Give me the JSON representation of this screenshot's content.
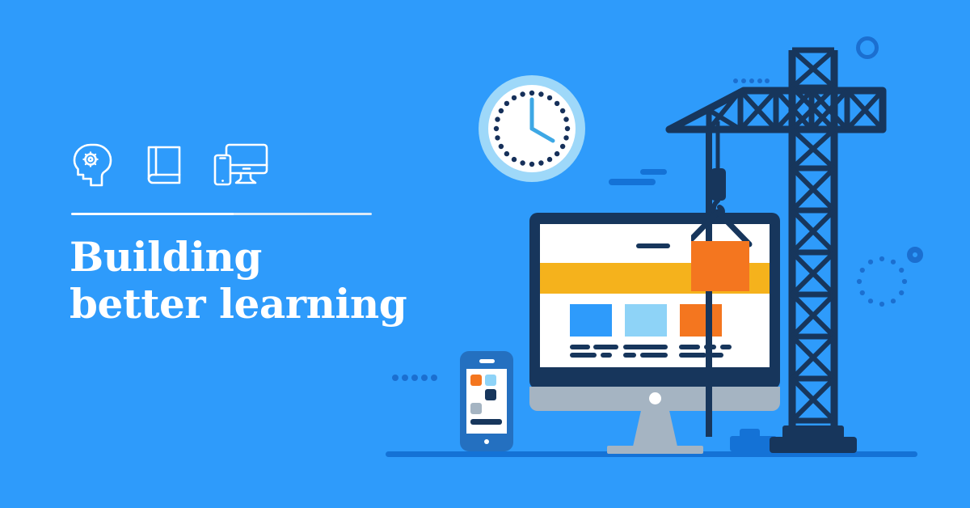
{
  "banner": {
    "background_color": "#2e9bfb",
    "headline_line1": "Building",
    "headline_line2": "better learning",
    "headline_color": "#ffffff",
    "divider_color": "#ffffff"
  },
  "icons": [
    {
      "name": "head-gear-icon",
      "label": "Head with gear"
    },
    {
      "name": "book-icon",
      "label": "Book"
    },
    {
      "name": "devices-icon",
      "label": "Phone and desktop monitor"
    }
  ],
  "illustration": {
    "clock": {
      "name": "wall-clock",
      "ring_color": "#9ed8f9",
      "face_color": "#ffffff",
      "tick_color": "#16305a",
      "hand_color": "#3ea8e5",
      "tick_count": 24,
      "hour_hand_position": "4",
      "minute_hand_position": "12"
    },
    "monitor": {
      "name": "desktop-monitor",
      "bezel_color": "#17365c",
      "screen_color": "#ffffff",
      "band_color": "#f5b21c",
      "stand_color": "#a5b4c2",
      "cards": [
        {
          "name": "card-blue",
          "color": "#2e9bfb"
        },
        {
          "name": "card-light-blue",
          "color": "#8ed3f7"
        },
        {
          "name": "card-orange",
          "color": "#f4761f"
        }
      ],
      "text_line_color": "#17365c"
    },
    "phone": {
      "name": "smartphone",
      "body_color": "#2470c0",
      "screen_color": "#ffffff",
      "tiles": [
        {
          "name": "tile-orange",
          "color": "#f4761f"
        },
        {
          "name": "tile-light-blue",
          "color": "#8ed3f7"
        },
        {
          "name": "tile-navy",
          "color": "#17365c"
        },
        {
          "name": "tile-gray",
          "color": "#a5b4c2"
        }
      ],
      "bar_color": "#17365c"
    },
    "crane": {
      "name": "construction-crane",
      "structure_color": "#17365c",
      "cable_color": "#17365c",
      "hook_color": "#17365c",
      "crate_color": "#f4761f"
    },
    "ground": {
      "name": "ground-line",
      "color": "#1472d6"
    },
    "decorations": [
      {
        "name": "ring-outline-large",
        "color": "#1b6fd0"
      },
      {
        "name": "ring-outline-small",
        "color": "#1b6fd0"
      },
      {
        "name": "dotted-circle",
        "color": "#1b6fd0",
        "dot_count": 12
      },
      {
        "name": "dot-group-left",
        "color": "#1b6fd0",
        "dot_count": 5
      },
      {
        "name": "dot-group-crane",
        "color": "#1b6fd0",
        "dot_count": 5
      },
      {
        "name": "speed-bar-upper",
        "color": "#1472d6"
      },
      {
        "name": "speed-bar-lower",
        "color": "#1472d6"
      },
      {
        "name": "lego-block",
        "color": "#1472d6"
      }
    ]
  }
}
